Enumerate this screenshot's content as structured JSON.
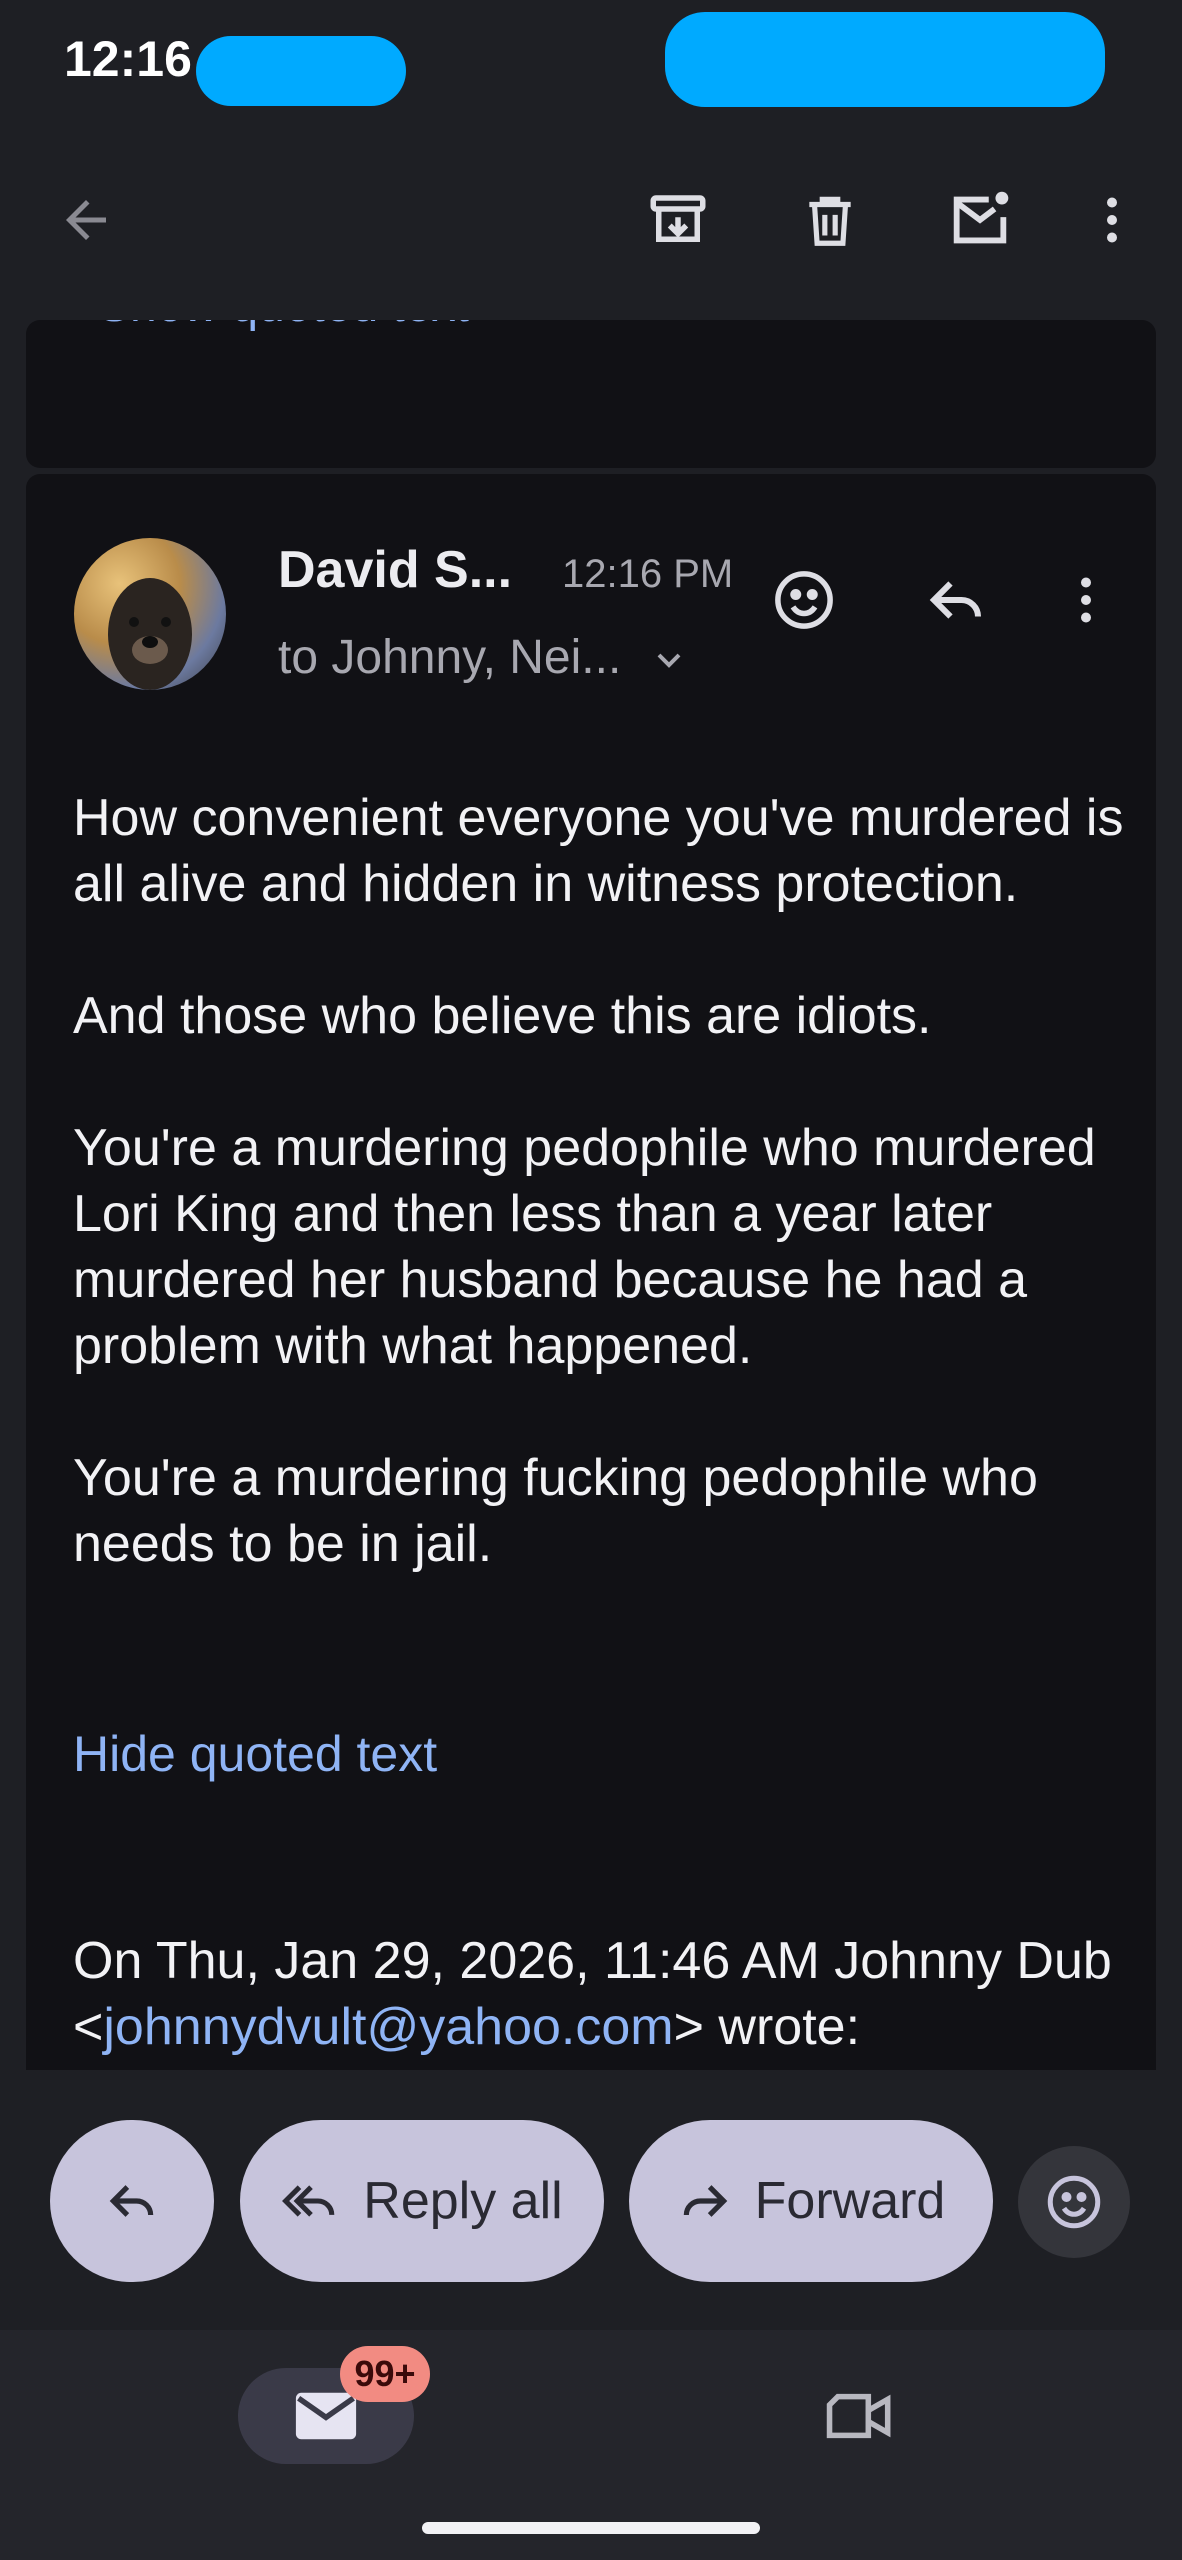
{
  "status_bar": {
    "time": "12:16"
  },
  "toolbar": {
    "icons": [
      "back-arrow-icon",
      "archive-icon",
      "trash-icon",
      "mark-unread-icon",
      "more-vert-icon"
    ]
  },
  "prev_message": {
    "show_quoted_label": "Show quoted text"
  },
  "message": {
    "sender": "David S...",
    "time": "12:16 PM",
    "recipients": "to Johnny, Nei...",
    "body": [
      "How convenient everyone you've murdered is all alive and hidden in witness protection.",
      "And those who believe this are idiots.",
      "You're a murdering pedophile who murdered Lori King and then less than a year later murdered her husband because he had a problem with what happened.",
      "You're a murdering fucking pedophile who needs to be in jail."
    ],
    "hide_quoted_label": "Hide quoted text",
    "quote_header": {
      "prefix": "On Thu, Jan 29, 2026, 11:46 AM Johnny Dub <",
      "email": "johnnydvult@yahoo.com",
      "suffix": "> wrote:"
    }
  },
  "actions": {
    "reply_all": "Reply all",
    "forward": "Forward"
  },
  "bottom_nav": {
    "mail_badge": "99+"
  },
  "colors": {
    "background": "#1e1f24",
    "card": "#111115",
    "link": "#8fb4f5",
    "pill": "#c7c4dc",
    "badge": "#f28b82"
  }
}
